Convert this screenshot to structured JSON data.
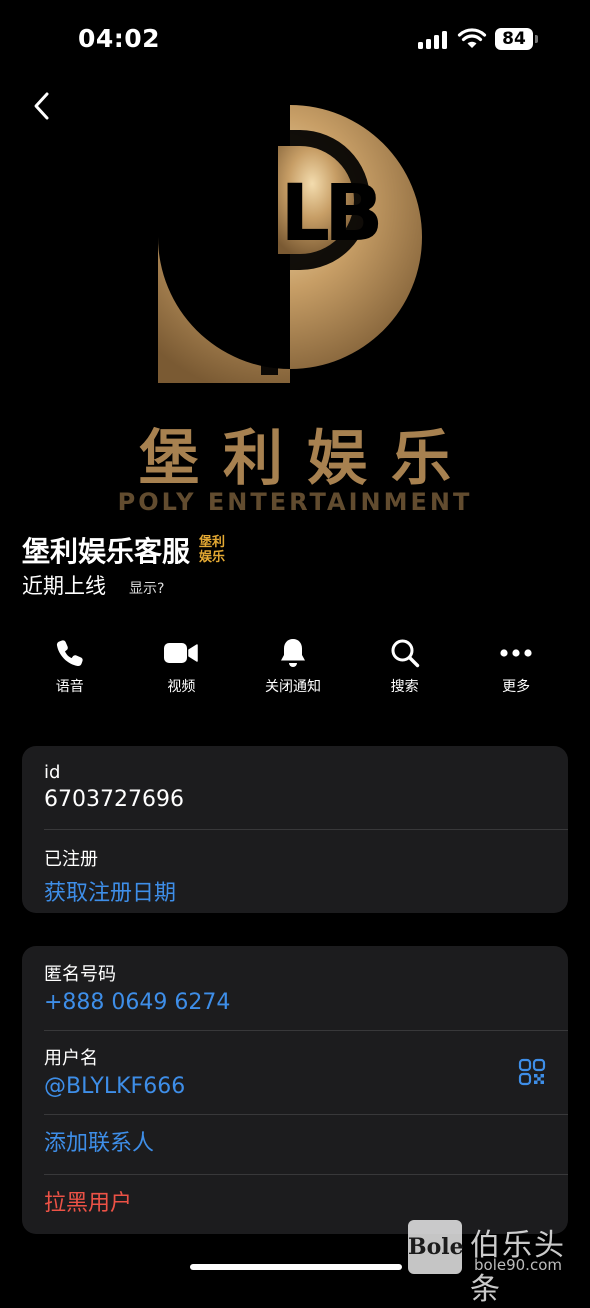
{
  "status_bar": {
    "time": "04:02",
    "battery": "84"
  },
  "hero": {
    "logo_text": "LB",
    "title": "堡利娱乐",
    "subtitle": "POLY ENTERTAINMENT"
  },
  "profile": {
    "name": "堡利娱乐客服",
    "badge_line1": "堡利",
    "badge_line2": "娱乐",
    "status": "近期上线",
    "show": "显示?"
  },
  "actions": [
    {
      "label": "语音",
      "icon": "phone-icon"
    },
    {
      "label": "视频",
      "icon": "video-icon"
    },
    {
      "label": "关闭通知",
      "icon": "bell-icon"
    },
    {
      "label": "搜索",
      "icon": "search-icon"
    },
    {
      "label": "更多",
      "icon": "more-icon"
    }
  ],
  "info_card": {
    "id_label": "id",
    "id_value": "6703727696",
    "registered_label": "已注册",
    "registered_value": "获取注册日期"
  },
  "contact_card": {
    "anon_label": "匿名号码",
    "anon_value": "+888 0649 6274",
    "username_label": "用户名",
    "username_value": "@BLYLKF666",
    "add_contact": "添加联系人",
    "block_user": "拉黑用户"
  },
  "watermark": {
    "logo": "Bole",
    "text": "伯乐头条",
    "url": "bole90.com"
  },
  "colors": {
    "link": "#3e8ee8",
    "danger": "#ec5246",
    "gold": "#b38b57",
    "card": "#1c1c1e"
  }
}
